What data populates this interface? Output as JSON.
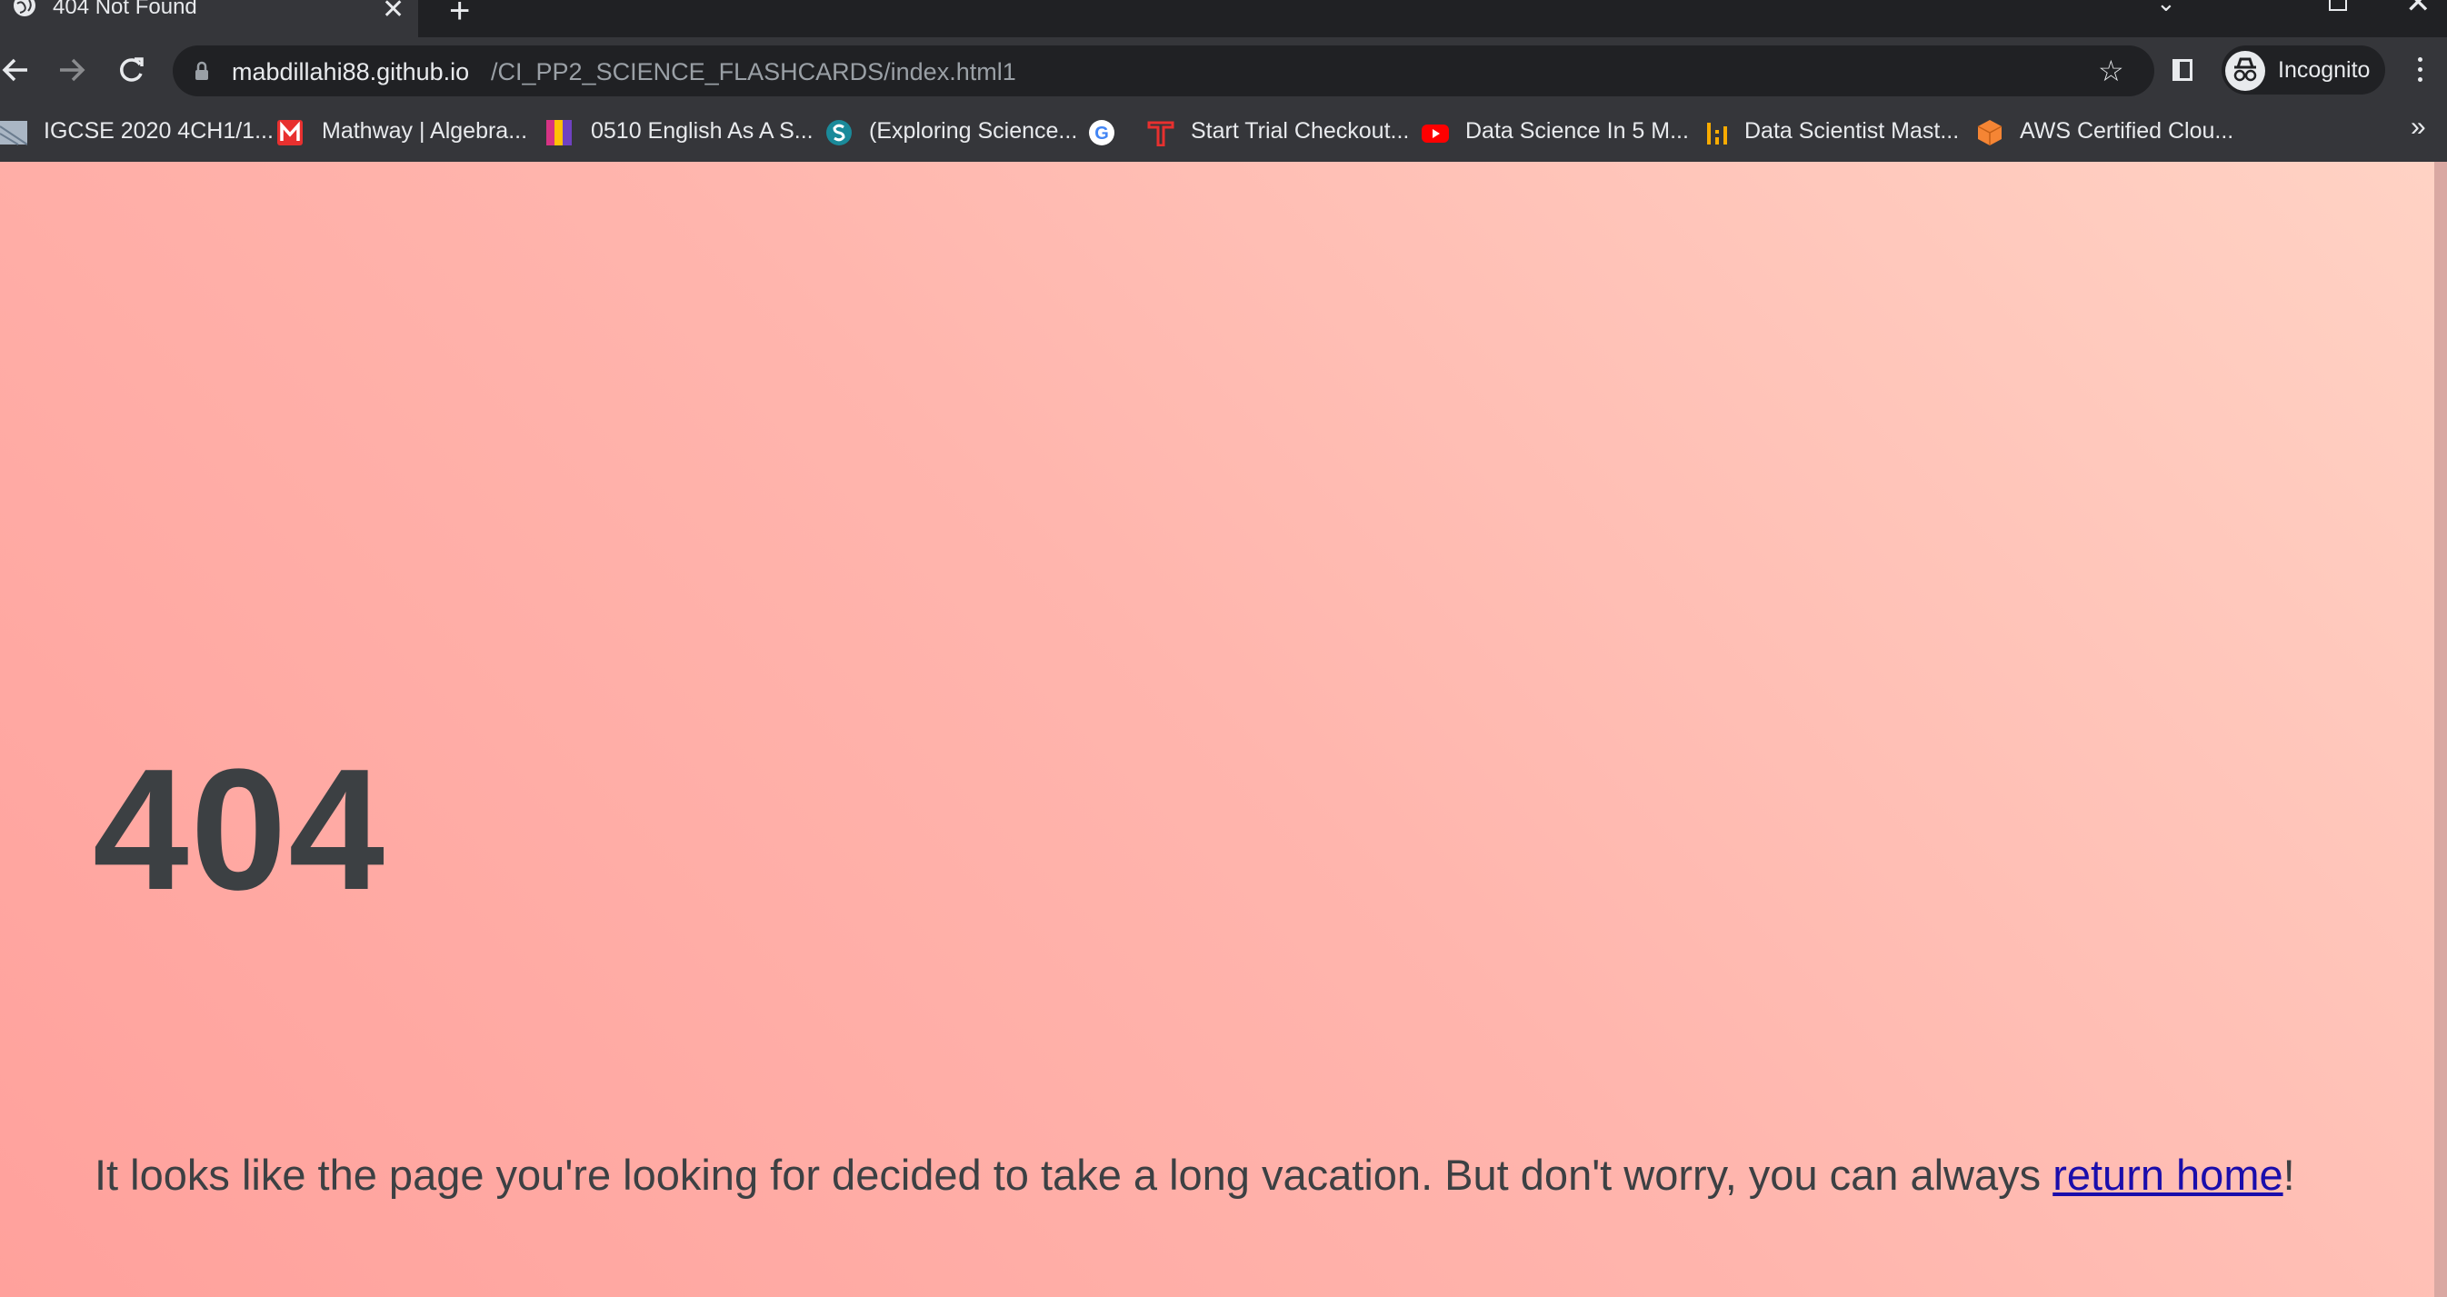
{
  "browser": {
    "tab": {
      "title": "404 Not Found"
    },
    "address_bar": {
      "host": "mabdillahi88.github.io",
      "path": "/CI_PP2_SCIENCE_FLASHCARDS/index.html1"
    },
    "profile_label": "Incognito",
    "bookmarks": [
      {
        "label": "IGCSE 2020 4CH1/1...",
        "icon": "document-thumbnail-icon"
      },
      {
        "label": "Mathway | Algebra...",
        "icon": "mathway-icon"
      },
      {
        "label": "0510 English As A S...",
        "icon": "colorful-book-icon"
      },
      {
        "label": "(Exploring Science...",
        "icon": "teal-circle-s-icon"
      },
      {
        "label": "",
        "icon": "google-icon"
      },
      {
        "label": "Start Trial Checkout...",
        "icon": "red-t-icon"
      },
      {
        "label": "Data Science In 5 M...",
        "icon": "youtube-icon"
      },
      {
        "label": "Data Scientist Mast...",
        "icon": "bars-icon"
      },
      {
        "label": "AWS Certified Clou...",
        "icon": "orange-cube-icon"
      }
    ]
  },
  "page": {
    "code": "404",
    "message_before": "It looks like the page you're looking for decided to take a long vacation. But don't worry, you can always ",
    "link_text": "return home",
    "message_after": "!"
  }
}
